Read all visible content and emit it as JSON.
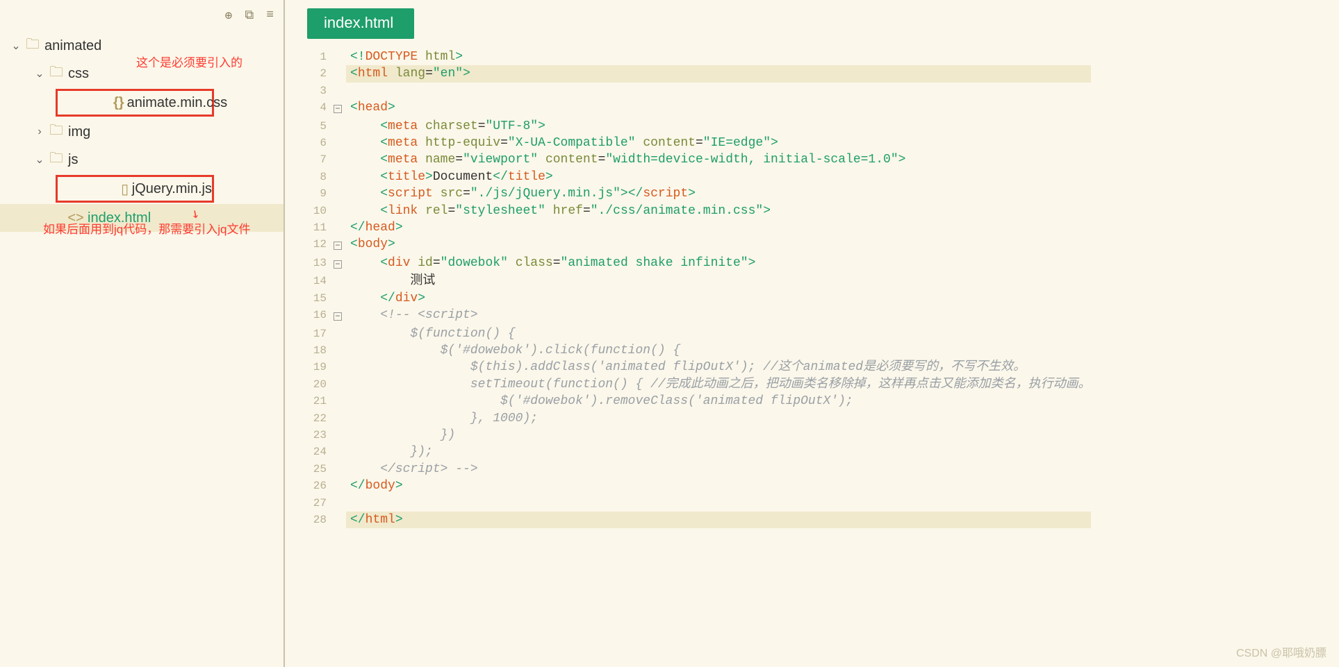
{
  "sidebar": {
    "items": [
      {
        "label": "animated",
        "expanded": true,
        "indent": 0,
        "type": "folder"
      },
      {
        "label": "css",
        "expanded": true,
        "indent": 1,
        "type": "folder"
      },
      {
        "label": "animate.min.css",
        "indent": 2,
        "type": "css",
        "boxed": true
      },
      {
        "label": "img",
        "expanded": false,
        "indent": 1,
        "type": "folder"
      },
      {
        "label": "js",
        "expanded": true,
        "indent": 1,
        "type": "folder"
      },
      {
        "label": "jQuery.min.js",
        "indent": 2,
        "type": "js",
        "boxed": true
      },
      {
        "label": "index.html",
        "indent": 2,
        "type": "html",
        "active": true
      }
    ],
    "annotations": {
      "top": "这个是必须要引入的",
      "bottom": "如果后面用到jq代码，那需要引入jq文件"
    }
  },
  "tab": {
    "label": "index.html"
  },
  "code": {
    "lines": [
      {
        "n": 1,
        "html": "<span class='br'>&lt;!</span><span class='tagn'>DOCTYPE</span> <span class='attr'>html</span><span class='br'>&gt;</span>"
      },
      {
        "n": 2,
        "cls": "hl-line2",
        "html": "<span class='br'>&lt;</span><span class='tagn'>html</span> <span class='attr'>lang</span>=<span class='str'>\"en\"</span><span class='br'>&gt;</span>"
      },
      {
        "n": 3,
        "html": ""
      },
      {
        "n": 4,
        "fold": "-",
        "html": "<span class='br'>&lt;</span><span class='tagn'>head</span><span class='br'>&gt;</span>"
      },
      {
        "n": 5,
        "html": "    <span class='br'>&lt;</span><span class='tagn'>meta</span> <span class='attr'>charset</span>=<span class='str'>\"UTF-8\"</span><span class='br'>&gt;</span>"
      },
      {
        "n": 6,
        "html": "    <span class='br'>&lt;</span><span class='tagn'>meta</span> <span class='attr'>http-equiv</span>=<span class='str'>\"X-UA-Compatible\"</span> <span class='attr'>content</span>=<span class='str'>\"IE=edge\"</span><span class='br'>&gt;</span>"
      },
      {
        "n": 7,
        "html": "    <span class='br'>&lt;</span><span class='tagn'>meta</span> <span class='attr'>name</span>=<span class='str'>\"viewport\"</span> <span class='attr'>content</span>=<span class='str'>\"width=device-width, initial-scale=1.0\"</span><span class='br'>&gt;</span>"
      },
      {
        "n": 8,
        "html": "    <span class='br'>&lt;</span><span class='tagn'>title</span><span class='br'>&gt;</span><span class='txt'>Document</span><span class='br'>&lt;/</span><span class='tagn'>title</span><span class='br'>&gt;</span>"
      },
      {
        "n": 9,
        "html": "    <span class='br'>&lt;</span><span class='tagn'>script</span> <span class='attr'>src</span>=<span class='str'>\"./js/jQuery.min.js\"</span><span class='br'>&gt;&lt;/</span><span class='tagn'>script</span><span class='br'>&gt;</span>"
      },
      {
        "n": 10,
        "html": "    <span class='br'>&lt;</span><span class='tagn'>link</span> <span class='attr'>rel</span>=<span class='str'>\"stylesheet\"</span> <span class='attr'>href</span>=<span class='str'>\"./css/animate.min.css\"</span><span class='br'>&gt;</span>"
      },
      {
        "n": 11,
        "html": "<span class='br'>&lt;/</span><span class='tagn'>head</span><span class='br'>&gt;</span>"
      },
      {
        "n": 12,
        "fold": "-",
        "html": "<span class='br'>&lt;</span><span class='tagn'>body</span><span class='br'>&gt;</span>"
      },
      {
        "n": 13,
        "fold": "-",
        "html": "    <span class='br'>&lt;</span><span class='tagn'>div</span> <span class='attr'>id</span>=<span class='str'>\"dowebok\"</span> <span class='attr'>class</span>=<span class='str'>\"animated shake infinite\"</span><span class='br'>&gt;</span>"
      },
      {
        "n": 14,
        "html": "        <span class='txt'>测试</span>"
      },
      {
        "n": 15,
        "html": "    <span class='br'>&lt;/</span><span class='tagn'>div</span><span class='br'>&gt;</span>"
      },
      {
        "n": 16,
        "fold": "-",
        "html": "    <span class='cmt'>&lt;!-- &lt;script&gt;</span>"
      },
      {
        "n": 17,
        "html": "        <span class='cmt'>$(function() {</span>"
      },
      {
        "n": 18,
        "html": "            <span class='cmt'>$('#dowebok').click(function() {</span>"
      },
      {
        "n": 19,
        "html": "                <span class='cmt'>$(this).addClass('animated flipOutX'); //这个animated是必须要写的，不写不生效。</span>"
      },
      {
        "n": 20,
        "html": "                <span class='cmt'>setTimeout(function() { //完成此动画之后，把动画类名移除掉，这样再点击又能添加类名，执行动画。</span>"
      },
      {
        "n": 21,
        "html": "                    <span class='cmt'>$('#dowebok').removeClass('animated flipOutX');</span>"
      },
      {
        "n": 22,
        "html": "                <span class='cmt'>}, 1000);</span>"
      },
      {
        "n": 23,
        "html": "            <span class='cmt'>})</span>"
      },
      {
        "n": 24,
        "html": "        <span class='cmt'>});</span>"
      },
      {
        "n": 25,
        "html": "    <span class='cmt'>&lt;/script&gt; --&gt;</span>"
      },
      {
        "n": 26,
        "html": "<span class='br'>&lt;/</span><span class='tagn'>body</span><span class='br'>&gt;</span>"
      },
      {
        "n": 27,
        "html": ""
      },
      {
        "n": 28,
        "cls": "hl-end",
        "html": "<span class='br'>&lt;/</span><span class='tagn'>html</span><span class='br'>&gt;</span>"
      }
    ]
  },
  "watermark": "CSDN @耶哦奶膘"
}
